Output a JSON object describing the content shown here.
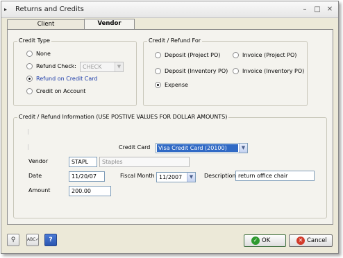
{
  "window": {
    "title": "Returns and Credits"
  },
  "tabs": [
    {
      "label": "Client"
    },
    {
      "label": "Vendor"
    }
  ],
  "credit_type": {
    "title": "Credit Type",
    "options": [
      {
        "label": "None",
        "selected": false
      },
      {
        "label": "Refund Check:",
        "selected": false
      },
      {
        "label": "Refund on Credit Card",
        "selected": true
      },
      {
        "label": "Credit on Account",
        "selected": false
      }
    ],
    "check_combo_value": "CHECK"
  },
  "refund_for": {
    "title": "Credit / Refund For",
    "options": [
      {
        "label": "Deposit (Project PO)",
        "selected": false
      },
      {
        "label": "Invoice (Project PO)",
        "selected": false
      },
      {
        "label": "Deposit (Inventory PO)",
        "selected": false
      },
      {
        "label": "Invoice (Inventory PO)",
        "selected": false
      },
      {
        "label": "Expense",
        "selected": true
      }
    ]
  },
  "info": {
    "title": "Credit / Refund Information (USE POSTIVE VALUES FOR DOLLAR AMOUNTS)",
    "credit_card_label": "Credit Card",
    "credit_card_value": "Visa Credit Card (20100)",
    "vendor_label": "Vendor",
    "vendor_code": "STAPL",
    "vendor_name": "Staples",
    "date_label": "Date",
    "date_value": "11/20/07",
    "fiscal_month_label": "Fiscal Month",
    "fiscal_month_value": "11/2007",
    "description_label": "Description",
    "description_value": "return office chair",
    "amount_label": "Amount",
    "amount_value": "200.00"
  },
  "buttons": {
    "ok_label": "OK",
    "cancel_label": "Cancel"
  },
  "icons": {
    "toolbar": [
      "key-icon",
      "spell-check-icon",
      "help-icon"
    ],
    "ok": "check-circle-icon",
    "cancel": "cancel-circle-icon"
  },
  "colors": {
    "selected_text": "#1a3aa8",
    "highlight": "#316ac5",
    "ok_icon": "#2e9a2e",
    "cancel_icon": "#d23a2a"
  }
}
